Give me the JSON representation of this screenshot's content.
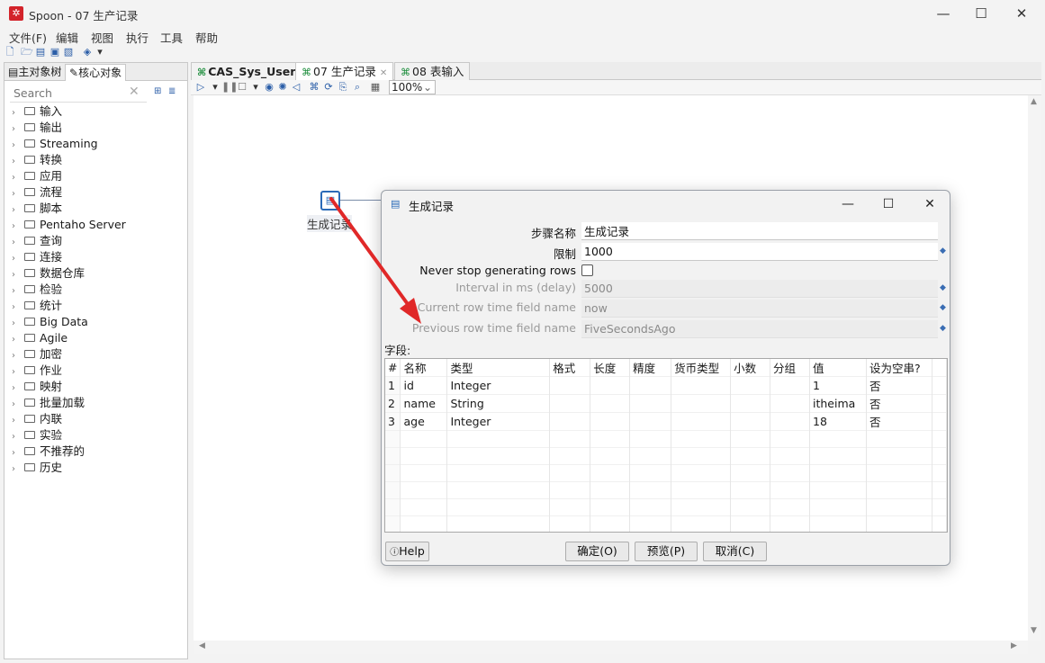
{
  "window": {
    "title": "Spoon - 07 生产记录",
    "minimize": "—",
    "maximize": "☐",
    "close": "✕"
  },
  "menu": [
    "文件(F)",
    "编辑",
    "视图",
    "执行",
    "工具",
    "帮助"
  ],
  "left_panel": {
    "tabs": [
      "主对象树",
      "核心对象"
    ],
    "search_placeholder": "Search",
    "tree": [
      "输入",
      "输出",
      "Streaming",
      "转换",
      "应用",
      "流程",
      "脚本",
      "Pentaho Server",
      "查询",
      "连接",
      "数据仓库",
      "检验",
      "统计",
      "Big Data",
      "Agile",
      "加密",
      "作业",
      "映射",
      "批量加载",
      "内联",
      "实验",
      "不推荐的",
      "历史"
    ]
  },
  "editor": {
    "tabs": [
      {
        "label": "CAS_Sys_User"
      },
      {
        "label": "07 生产记录"
      },
      {
        "label": "08 表输入"
      }
    ],
    "zoom": "100%",
    "step_label": "生成记录"
  },
  "dialog": {
    "title": "生成记录",
    "fields": {
      "step_name_label": "步骤名称",
      "step_name_value": "生成记录",
      "limit_label": "限制",
      "limit_value": "1000",
      "never_stop_label": "Never stop generating rows",
      "interval_label": "Interval in ms (delay)",
      "interval_value": "5000",
      "current_row_label": "Current row time field name",
      "current_row_value": "now",
      "previous_row_label": "Previous row time field name",
      "previous_row_value": "FiveSecondsAgo"
    },
    "fields_section_label": "字段:",
    "table": {
      "columns": [
        "#",
        "名称",
        "类型",
        "格式",
        "长度",
        "精度",
        "货币类型",
        "小数",
        "分组",
        "值",
        "设为空串?"
      ],
      "rows": [
        {
          "num": "1",
          "name": "id",
          "type": "Integer",
          "value": "1",
          "empty": "否"
        },
        {
          "num": "2",
          "name": "name",
          "type": "String",
          "value": "itheima",
          "empty": "否"
        },
        {
          "num": "3",
          "name": "age",
          "type": "Integer",
          "value": "18",
          "empty": "否"
        }
      ]
    },
    "buttons": {
      "help": "Help",
      "ok": "确定(O)",
      "preview": "预览(P)",
      "cancel": "取消(C)"
    }
  },
  "colors": {
    "accent": "#2a6ab8",
    "arrow": "#e02828"
  }
}
